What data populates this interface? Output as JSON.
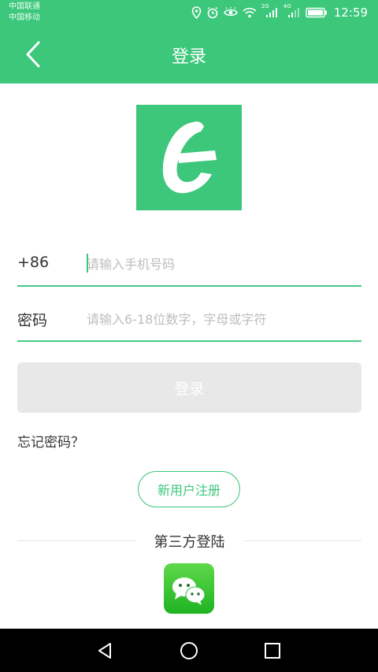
{
  "status_bar": {
    "carrier_1": "中国联通",
    "carrier_2": "中国移动",
    "network_1": "2G",
    "network_2": "4G",
    "time": "12:59",
    "icons": [
      "location-icon",
      "alarm-icon",
      "eye-icon",
      "wifi-icon",
      "signal-icon",
      "signal-icon",
      "battery-icon"
    ]
  },
  "header": {
    "title": "登录",
    "back_icon": "back-chevron-icon"
  },
  "logo": {
    "icon": "app-logo-icon"
  },
  "form": {
    "phone": {
      "prefix": "+86",
      "value": "",
      "placeholder": "请输入手机号码"
    },
    "password": {
      "label": "密码",
      "value": "",
      "placeholder": "请输入6-18位数字，字母或字符"
    },
    "login_label": "登录"
  },
  "forgot_password": "忘记密码？",
  "register_label": "新用户注册",
  "third_party": {
    "title": "第三方登陆",
    "icon": "wechat-icon"
  },
  "system_nav": {
    "icons": [
      "back-triangle-icon",
      "home-circle-icon",
      "recents-square-icon"
    ]
  },
  "colors": {
    "primary": "#3cc77b",
    "button_disabled": "#e8e8e8",
    "placeholder": "#bdbdbd",
    "text": "#333333"
  }
}
